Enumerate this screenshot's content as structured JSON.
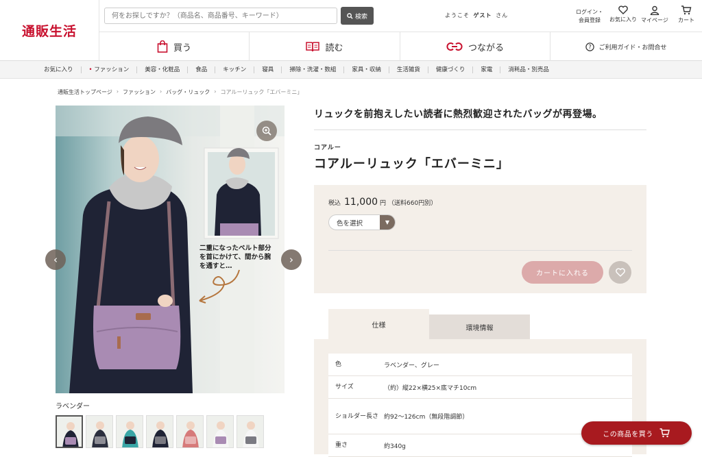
{
  "header": {
    "logo": "通販生活",
    "search_placeholder": "何をお探しですか？（商品名、商品番号、キーワード）",
    "search_button": "検索",
    "welcome_prefix": "ようこそ",
    "welcome_user": "ゲスト",
    "welcome_suffix": "さん",
    "login_line1": "ログイン・",
    "login_line2": "会員登録",
    "favorites": "お気に入り",
    "mypage": "マイページ",
    "cart": "カート"
  },
  "nav": {
    "buy": "買う",
    "read": "読む",
    "connect": "つながる",
    "help": "ご利用ガイド・お問合せ"
  },
  "categories": [
    "お気に入り",
    "ファッション",
    "美容・化粧品",
    "食品",
    "キッチン",
    "寝具",
    "掃除・洗濯・数組",
    "家具・収納",
    "生活雑貨",
    "健康づくり",
    "家電",
    "消耗品・別売品"
  ],
  "breadcrumb": [
    "通販生活トップページ",
    "ファッション",
    "バッグ・リュック",
    "コアルーリュック「エバーミニ」"
  ],
  "gallery": {
    "inset_caption": [
      "二重になったベルト部分",
      "を首にかけて、間から腕",
      "を通すと…"
    ],
    "color_label": "ラベンダー",
    "thumb_count": 7
  },
  "product": {
    "tagline": "リュックを前抱えしたい読者に熱烈歓迎されたバッグが再登場。",
    "brand": "コアルー",
    "title": "コアルーリュック「エバーミニ」",
    "price_prefix": "税込",
    "price": "11,000",
    "price_unit": "円",
    "shipping": "（送料660円別）",
    "color_select": "色を選択",
    "add_to_cart": "カートに入れる"
  },
  "tabs": [
    "仕様",
    "環境情報"
  ],
  "specs": [
    {
      "key": "色",
      "value": "ラベンダー、グレー"
    },
    {
      "key": "サイズ",
      "value": "（約）縦22×横25×底マチ10cm"
    },
    {
      "key": "ショルダー長さ",
      "value": "約92〜126cm（無段階調節）"
    },
    {
      "key": "重さ",
      "value": "約340g"
    }
  ],
  "buy_button": "この商品を買う",
  "colors": {
    "brand_red": "#c8102e",
    "buy_red": "#a81a1f",
    "beige": "#f4efe9",
    "cart_pink": "#dcaaaa"
  }
}
